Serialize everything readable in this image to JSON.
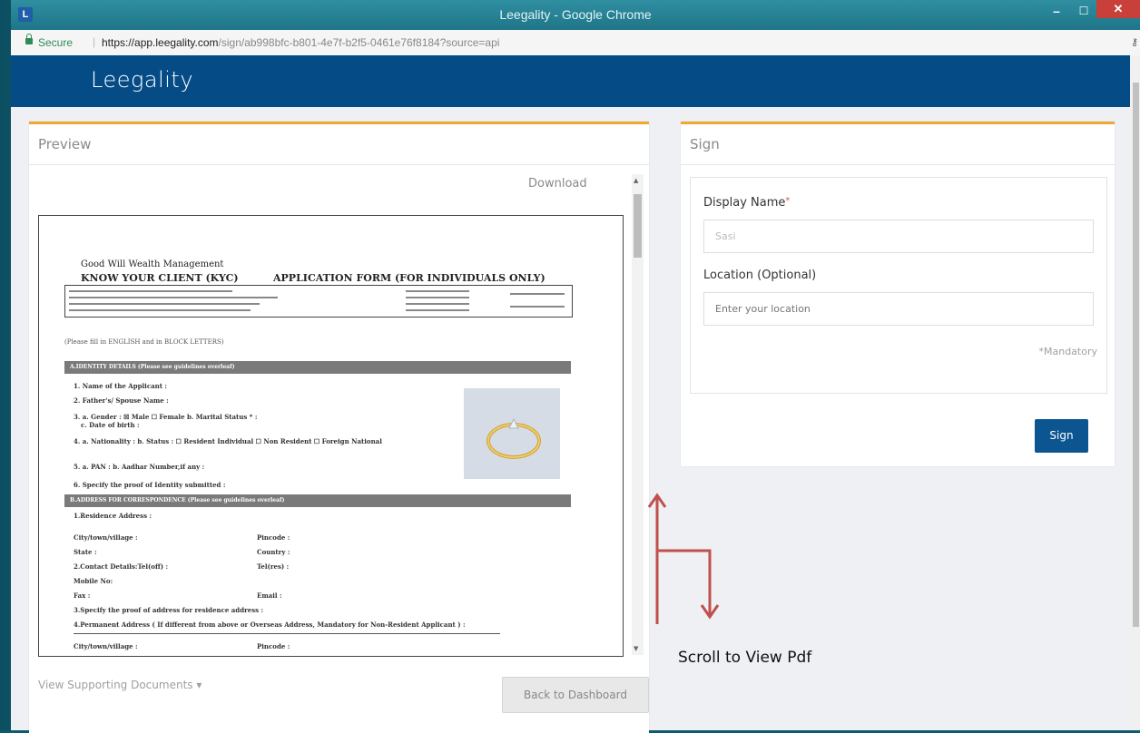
{
  "window": {
    "app_icon_label": "L",
    "title": "Leegality - Google Chrome",
    "minimize_glyph": "–",
    "maximize_glyph": "☐",
    "close_glyph": "✕"
  },
  "addressbar": {
    "secure_label": "Secure",
    "separator": "|",
    "url_host": "https://app.leegality.com",
    "url_rest": "/sign/ab998bfc-b801-4e7f-b2f5-0461e76f8184?source=api",
    "key_icon": "key-icon"
  },
  "navbar": {
    "brand": "Leegality"
  },
  "preview": {
    "title": "Preview",
    "download_label": "Download",
    "pdf": {
      "company_header": "Good Will Wealth Management",
      "kyc_title": "KNOW YOUR CLIENT (KYC)",
      "form_title": "APPLICATION FORM (FOR INDIVIDUALS ONLY)",
      "instruction": "(Please fill in ENGLISH and in BLOCK LETTERS)",
      "section_a": "A.IDENTITY DETAILS (Please see guidelines overleaf)",
      "field_1": "1. Name of the Applicant :",
      "field_2": "2. Father's/ Spouse Name :",
      "field_3a": "3. a. Gender :  ☒ Male  ☐ Female   b. Marital Status * :",
      "field_3c": "c. Date of birth :",
      "field_4": "4. a. Nationality :       b. Status : ☐ Resident Individual ☐ Non Resident ☐ Foreign National",
      "field_5": "5. a. PAN :            b. Aadhar Number,if any :",
      "field_6": "6. Specify the proof of Identity submitted :",
      "section_b": "B.ADDRESS FOR CORRESPONDENCE (Please see guidelines overleaf)",
      "addr_1": "1.Residence Address :",
      "addr_city": "City/town/village :",
      "addr_pincode": "Pincode :",
      "addr_state": "State :",
      "addr_country": "Country :",
      "addr_contact": "2.Contact Details:Tel(off) :",
      "addr_tel": "Tel(res) :",
      "addr_mobile": "Mobile No:",
      "addr_fax": "Fax :",
      "addr_email": "Email :",
      "addr_3": "3.Specify the proof of address for residence address :",
      "addr_4": "4.Permanent Address ( If different from above or Overseas Address, Mandatory for Non-Resident Applicant ) :",
      "addr_city2": "City/town/village :",
      "addr_pincode2": "Pincode :"
    },
    "support_docs_label": "View Supporting Documents ▾",
    "back_label": "Back to Dashboard"
  },
  "sign": {
    "title": "Sign",
    "display_name_label": "Display Name",
    "required_mark": "*",
    "display_name_value": "Sasi",
    "location_label": "Location (Optional)",
    "location_placeholder": "Enter your location",
    "mandatory_note": "*Mandatory",
    "sign_button": "Sign"
  },
  "annotation": {
    "text": "Scroll to View Pdf",
    "color": "#c0504d"
  },
  "colors": {
    "navbar": "#054c87",
    "accent": "#f0a832",
    "sign_button": "#0c5591"
  }
}
